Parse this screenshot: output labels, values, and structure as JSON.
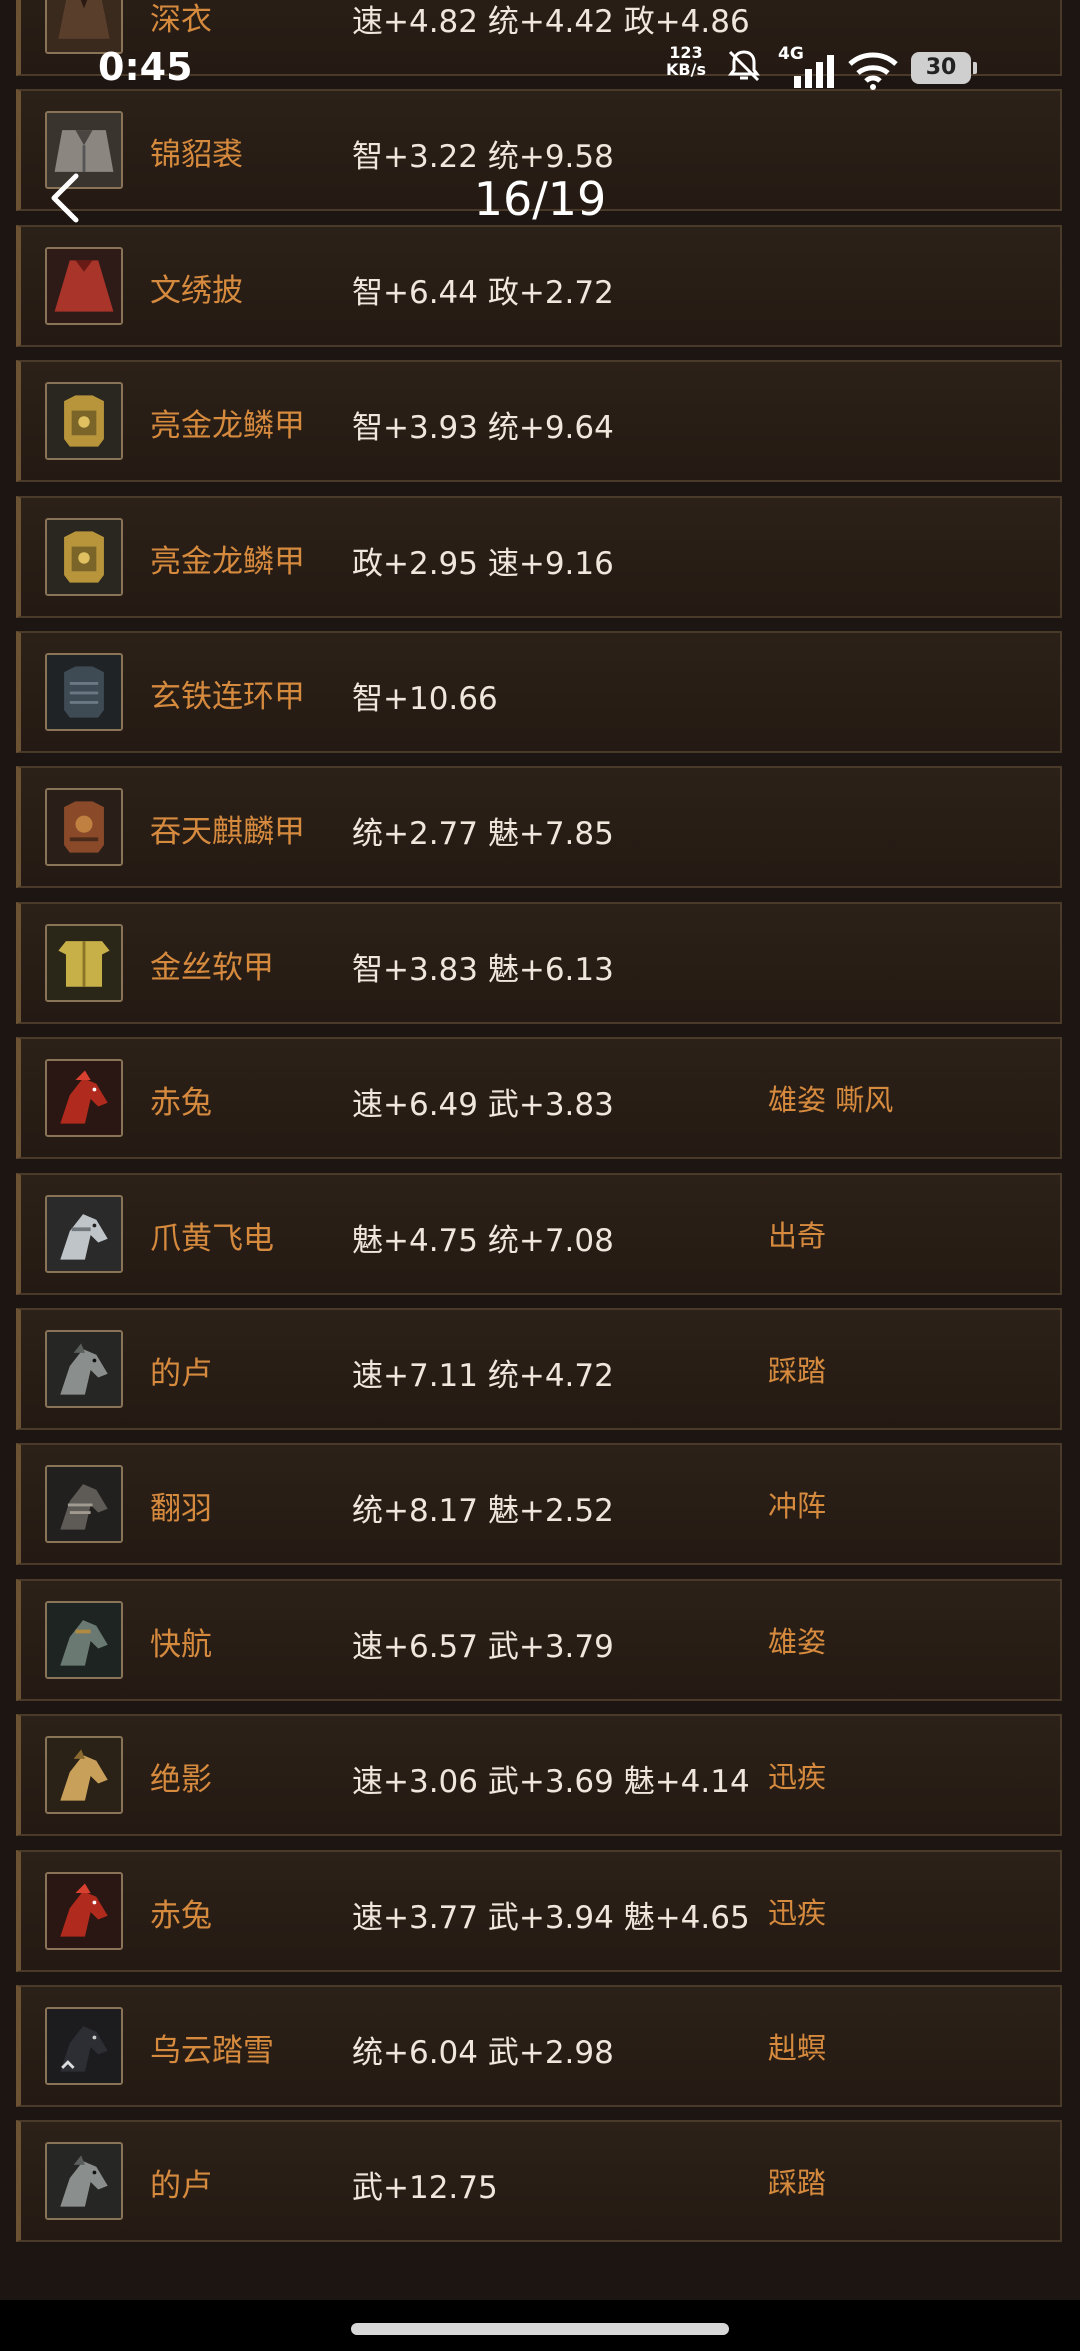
{
  "status_bar": {
    "time": "0:45",
    "net_speed_value": "123",
    "net_speed_unit": "KB/s",
    "network_type": "4G",
    "battery": "30"
  },
  "header": {
    "page_counter": "16/19"
  },
  "items": [
    {
      "name": "深衣",
      "stats": "速+4.82 统+4.42 政+4.86",
      "skill": "",
      "icon": "robe-icon"
    },
    {
      "name": "锦貂裘",
      "stats": "智+3.22 统+9.58",
      "skill": "",
      "icon": "fur-coat-icon"
    },
    {
      "name": "文绣披",
      "stats": "智+6.44 政+2.72",
      "skill": "",
      "icon": "cloak-icon"
    },
    {
      "name": "亮金龙鳞甲",
      "stats": "智+3.93 统+9.64",
      "skill": "",
      "icon": "gold-armor-icon"
    },
    {
      "name": "亮金龙鳞甲",
      "stats": "政+2.95 速+9.16",
      "skill": "",
      "icon": "gold-armor-icon"
    },
    {
      "name": "玄铁连环甲",
      "stats": "智+10.66",
      "skill": "",
      "icon": "iron-armor-icon"
    },
    {
      "name": "吞天麒麟甲",
      "stats": "统+2.77 魅+7.85",
      "skill": "",
      "icon": "qilin-armor-icon"
    },
    {
      "name": "金丝软甲",
      "stats": "智+3.83 魅+6.13",
      "skill": "",
      "icon": "silk-armor-icon"
    },
    {
      "name": "赤兔",
      "stats": "速+6.49 武+3.83",
      "skill": "雄姿 嘶风",
      "icon": "red-horse-icon"
    },
    {
      "name": "爪黄飞电",
      "stats": "魅+4.75 统+7.08",
      "skill": "出奇",
      "icon": "white-horse-icon"
    },
    {
      "name": "的卢",
      "stats": "速+7.11 统+4.72",
      "skill": "踩踏",
      "icon": "grey-horse-icon"
    },
    {
      "name": "翻羽",
      "stats": "统+8.17 魅+2.52",
      "skill": "冲阵",
      "icon": "armored-horse-icon"
    },
    {
      "name": "快航",
      "stats": "速+6.57 武+3.79",
      "skill": "雄姿",
      "icon": "steel-horse-icon"
    },
    {
      "name": "绝影",
      "stats": "速+3.06 武+3.69 魅+4.14",
      "skill": "迅疾",
      "icon": "golden-horse-icon"
    },
    {
      "name": "赤兔",
      "stats": "速+3.77 武+3.94 魅+4.65",
      "skill": "迅疾",
      "icon": "red-horse-icon"
    },
    {
      "name": "乌云踏雪",
      "stats": "统+6.04 武+2.98",
      "skill": "赳螟",
      "icon": "black-horse-icon"
    },
    {
      "name": "的卢",
      "stats": "武+12.75",
      "skill": "踩踏",
      "icon": "grey-horse-icon"
    }
  ],
  "colors": {
    "background": "#1c1511",
    "row_background": "#2a1f17",
    "row_border": "#4a3a2a",
    "name": "#d68a3e",
    "stats": "#efe6dc",
    "skill": "#d68a3e"
  }
}
